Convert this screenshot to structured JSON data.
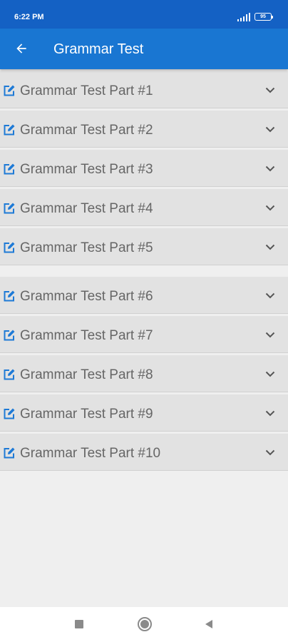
{
  "status_bar": {
    "time": "6:22 PM",
    "battery": "95"
  },
  "app_bar": {
    "title": "Grammar Test",
    "back_icon": "arrow-left-icon"
  },
  "list": {
    "items": [
      {
        "label": "Grammar Test Part #1"
      },
      {
        "label": "Grammar Test Part #2"
      },
      {
        "label": "Grammar Test Part #3"
      },
      {
        "label": "Grammar Test Part #4"
      },
      {
        "label": "Grammar Test Part #5"
      },
      {
        "label": "Grammar Test Part #6"
      },
      {
        "label": "Grammar Test Part #7"
      },
      {
        "label": "Grammar Test Part #8"
      },
      {
        "label": "Grammar Test Part #9"
      },
      {
        "label": "Grammar Test Part #10"
      }
    ],
    "item_icon": "edit-icon",
    "expand_icon": "chevron-down-icon"
  },
  "nav_bar": {
    "icons": [
      "recents-square-icon",
      "home-circle-icon",
      "back-triangle-icon"
    ]
  },
  "colors": {
    "status_bar": "#1461c4",
    "app_bar": "#1976d2",
    "accent_icon": "#1e7ad6",
    "row_bg": "#e2e2e2",
    "page_bg": "#efefef",
    "label_text": "#666666"
  }
}
